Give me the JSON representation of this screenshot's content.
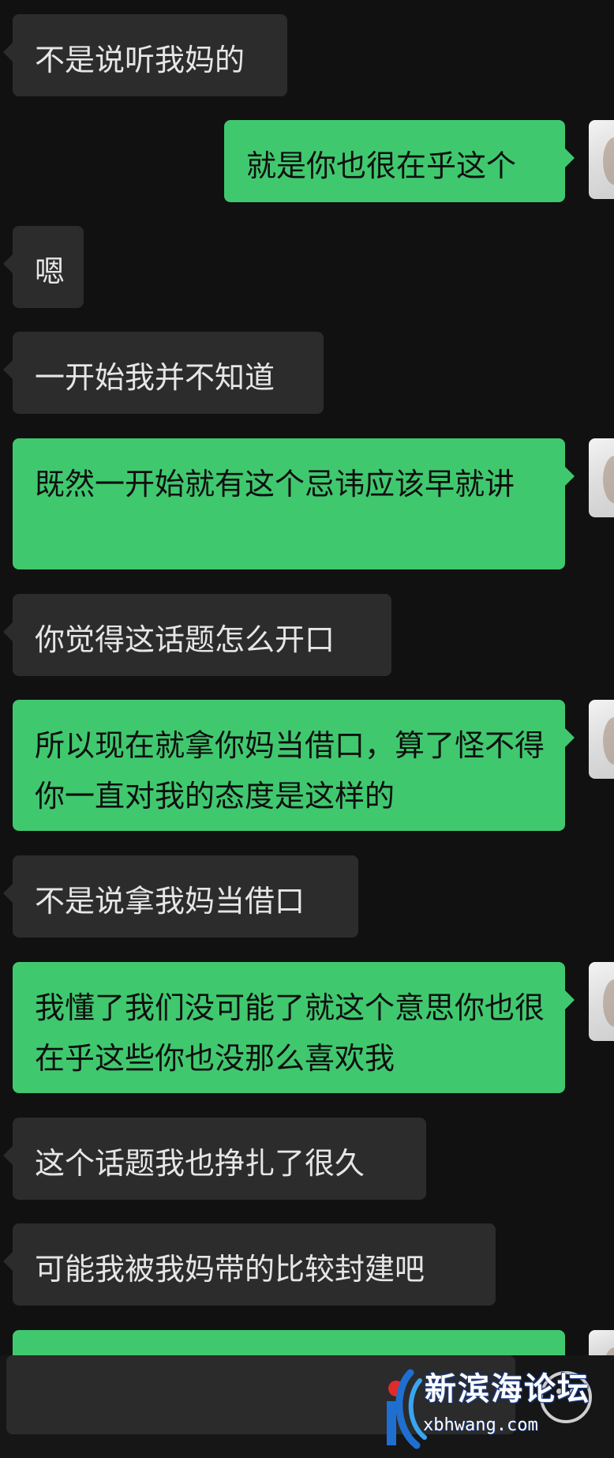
{
  "messages": [
    {
      "dir": "in",
      "text": "不是说听我妈的"
    },
    {
      "dir": "out",
      "text": "就是你也很在乎这个"
    },
    {
      "dir": "in",
      "text": "嗯"
    },
    {
      "dir": "in",
      "text": "一开始我并不知道"
    },
    {
      "dir": "out",
      "text": "既然一开始就有这个忌讳应该早就讲"
    },
    {
      "dir": "in",
      "text": "你觉得这话题怎么开口"
    },
    {
      "dir": "out",
      "text": "所以现在就拿你妈当借口，算了怪不得你一直对我的态度是这样的"
    },
    {
      "dir": "in",
      "text": "不是说拿我妈当借口"
    },
    {
      "dir": "out",
      "text": "我懂了我们没可能了就这个意思你也很在乎这些你也没那么喜欢我"
    },
    {
      "dir": "in",
      "text": "这个话题我也挣扎了很久"
    },
    {
      "dir": "in",
      "text": "可能我被我妈带的比较封建吧"
    }
  ],
  "watermark": {
    "name": "新滨海论坛",
    "url": "xbhwang.com"
  },
  "colors": {
    "background": "#111111",
    "incoming_bubble": "#2c2c2c",
    "outgoing_bubble": "#40c86f"
  },
  "icons": {
    "emoji": "emoji-icon",
    "logo": "forum-logo-icon"
  }
}
